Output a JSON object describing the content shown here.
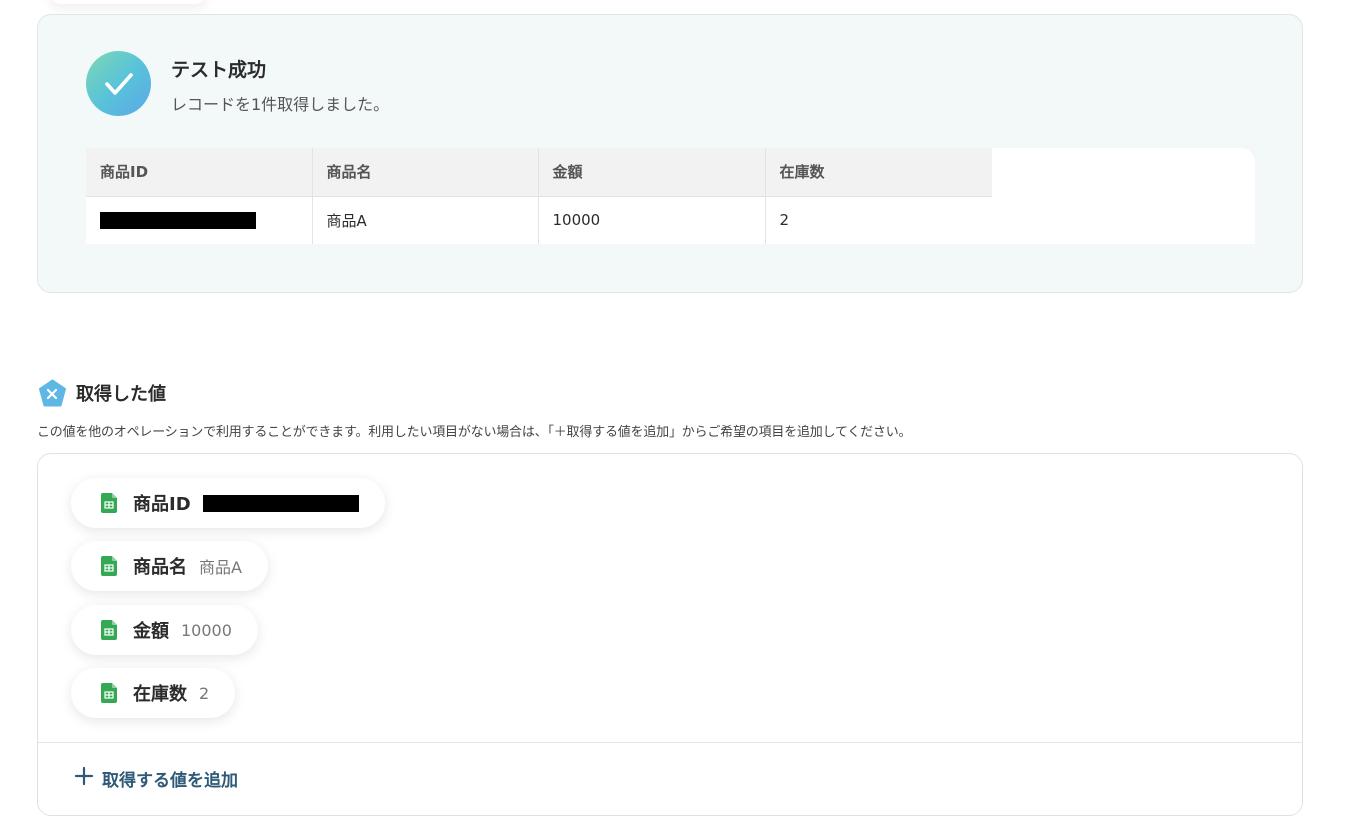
{
  "result": {
    "title": "テスト成功",
    "subtitle": "レコードを1件取得しました。",
    "table": {
      "headers": [
        "商品ID",
        "商品名",
        "金額",
        "在庫数"
      ],
      "row": [
        "",
        "商品A",
        "10000",
        "2"
      ]
    }
  },
  "acquired": {
    "title": "取得した値",
    "description": "この値を他のオペレーションで利用することができます。利用したい項目がない場合は、「＋取得する値を追加」からご希望の項目を追加してください。",
    "items": [
      {
        "key": "商品ID",
        "value": ""
      },
      {
        "key": "商品名",
        "value": "商品A"
      },
      {
        "key": "金額",
        "value": "10000"
      },
      {
        "key": "在庫数",
        "value": "2"
      }
    ],
    "add_label": "取得する値を追加",
    "add_icon": "plus-icon"
  },
  "colors": {
    "success_gradient": [
      "#7ed8b2",
      "#5aa8e8"
    ],
    "accent": "#2e5a78",
    "sheet_green": "#34a853"
  }
}
